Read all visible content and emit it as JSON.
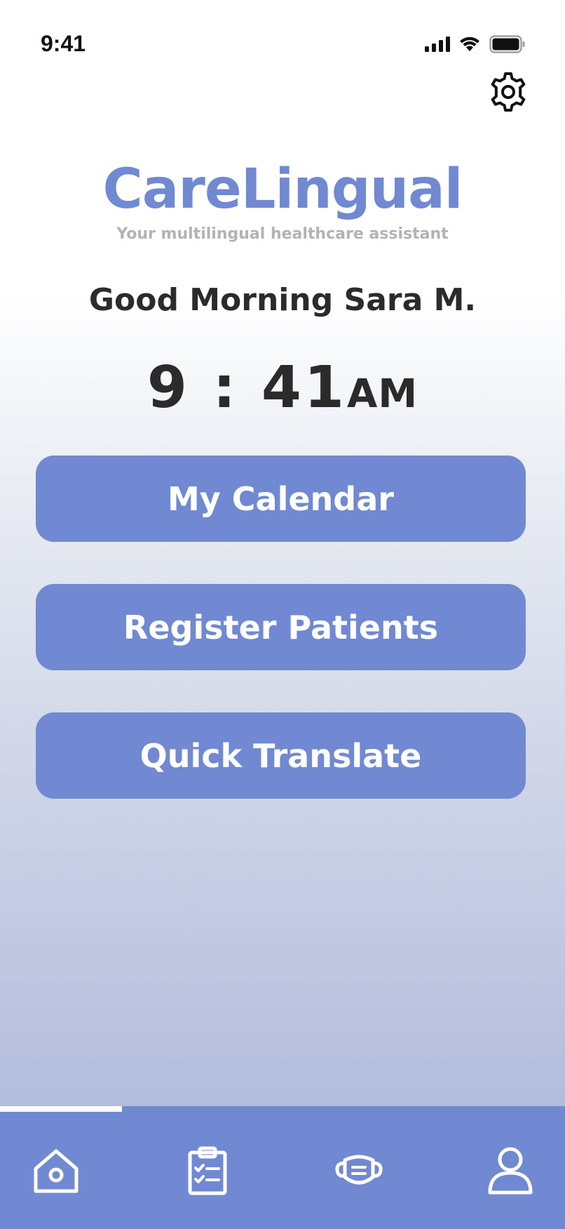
{
  "status_bar": {
    "time": "9:41"
  },
  "brand": {
    "title": "CareLingual",
    "subtitle": "Your multilingual  healthcare assistant"
  },
  "greeting": "Good Morning Sara M.",
  "clock": {
    "time": "9 : 41",
    "period": "AM"
  },
  "menu": {
    "calendar_label": "My Calendar",
    "register_label": "Register Patients",
    "translate_label": "Quick Translate"
  },
  "nav": {
    "items": [
      {
        "icon": "home-icon"
      },
      {
        "icon": "clipboard-checklist-icon"
      },
      {
        "icon": "face-mask-icon"
      },
      {
        "icon": "user-icon"
      }
    ],
    "active_index": 0
  },
  "colors": {
    "accent": "#7189d2",
    "text_dark": "#2b2b2b",
    "subtitle": "#b3b3b3"
  }
}
